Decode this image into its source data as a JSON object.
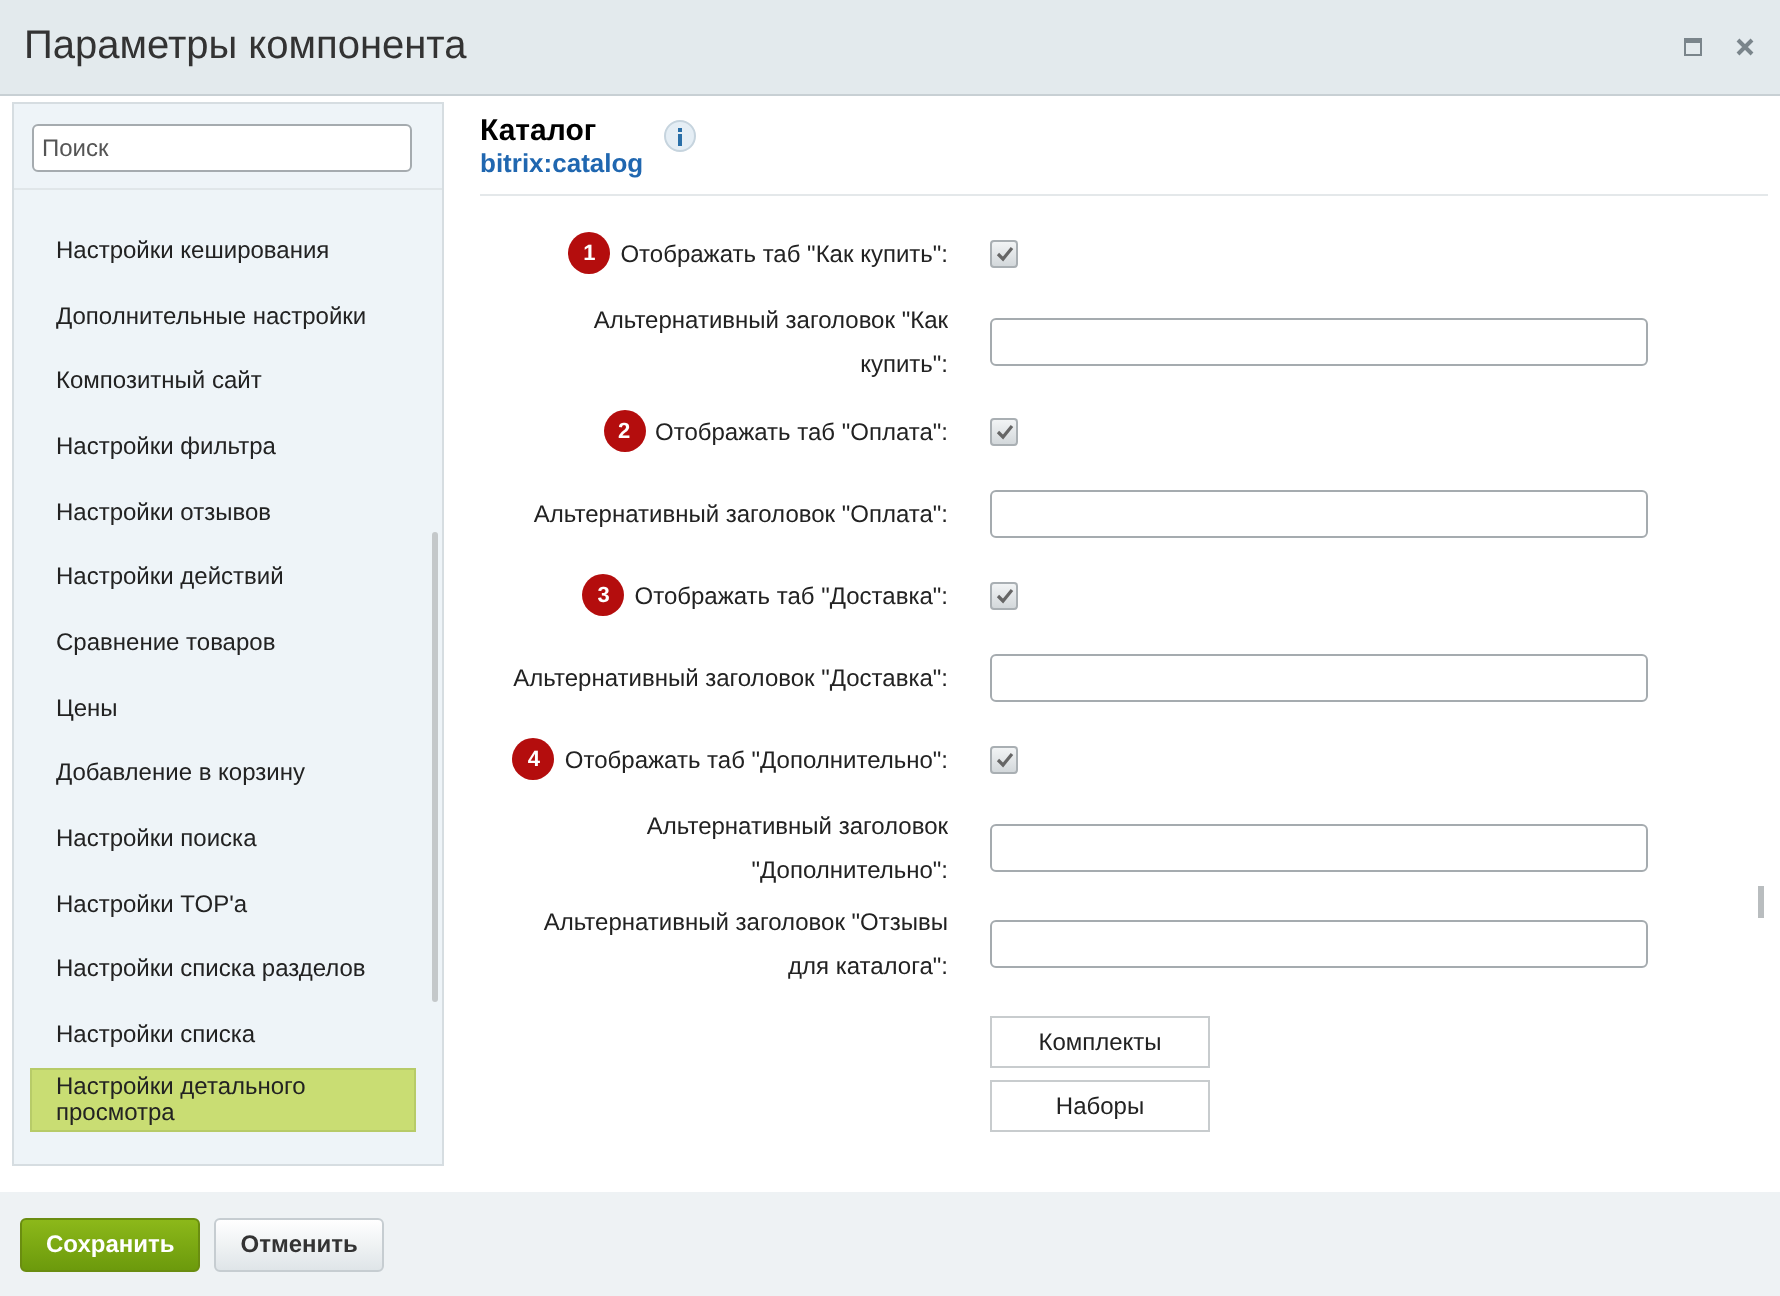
{
  "window": {
    "title": "Параметры компонента"
  },
  "sidebar": {
    "search": {
      "placeholder": "Поиск"
    },
    "items": [
      {
        "label": "Настройки кеширования",
        "selected": false
      },
      {
        "label": "Дополнительные настройки",
        "selected": false
      },
      {
        "label": "Композитный сайт",
        "selected": false
      },
      {
        "label": "Настройки фильтра",
        "selected": false
      },
      {
        "label": "Настройки отзывов",
        "selected": false
      },
      {
        "label": "Настройки действий",
        "selected": false
      },
      {
        "label": "Сравнение товаров",
        "selected": false
      },
      {
        "label": "Цены",
        "selected": false
      },
      {
        "label": "Добавление в корзину",
        "selected": false
      },
      {
        "label": "Настройки поиска",
        "selected": false
      },
      {
        "label": "Настройки TOP'а",
        "selected": false
      },
      {
        "label": "Настройки списка разделов",
        "selected": false
      },
      {
        "label": "Настройки списка",
        "selected": false
      },
      {
        "label": "Настройки детального просмотра",
        "selected": true
      }
    ]
  },
  "component": {
    "title": "Каталог",
    "code": "bitrix:catalog"
  },
  "fields": [
    {
      "kind": "checkbox",
      "badge": "1",
      "label": "Отображать таб \"Как купить\":",
      "checked": true
    },
    {
      "kind": "text",
      "label": "Альтернативный заголовок \"Как купить\":"
    },
    {
      "kind": "checkbox",
      "badge": "2",
      "label": "Отображать таб \"Оплата\":",
      "checked": true
    },
    {
      "kind": "text",
      "label": "Альтернативный заголовок \"Оплата\":"
    },
    {
      "kind": "checkbox",
      "badge": "3",
      "label": "Отображать таб \"Доставка\":",
      "checked": true
    },
    {
      "kind": "text",
      "label": "Альтернативный заголовок \"Доставка\":"
    },
    {
      "kind": "checkbox",
      "badge": "4",
      "label": "Отображать таб \"Дополнительно\":",
      "checked": true
    },
    {
      "kind": "text",
      "label": "Альтернативный заголовок \"Дополнительно\":"
    },
    {
      "kind": "text",
      "label": "Альтернативный заголовок \"Отзывы для каталога\":"
    }
  ],
  "option_buttons": [
    "Комплекты",
    "Наборы"
  ],
  "footer": {
    "buttons": [
      {
        "label": "Сохранить",
        "kind": "primary"
      },
      {
        "label": "Отменить",
        "kind": "secondary"
      }
    ]
  }
}
